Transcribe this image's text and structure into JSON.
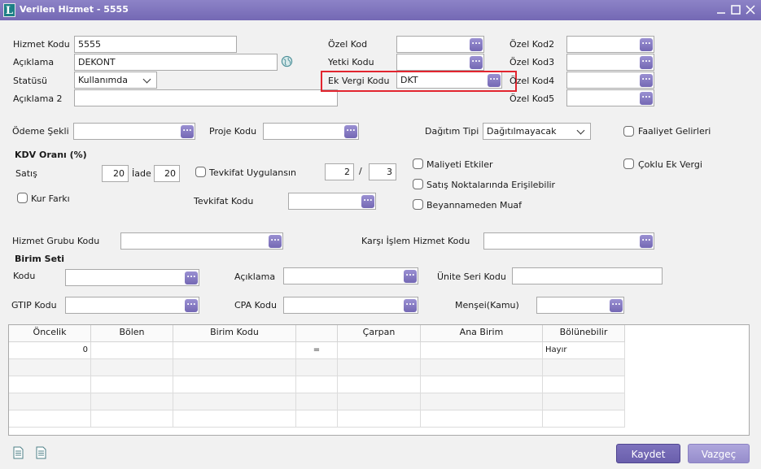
{
  "window": {
    "title": "Verilen Hizmet - 5555"
  },
  "form": {
    "hizmet_kodu_label": "Hizmet Kodu",
    "hizmet_kodu": "5555",
    "aciklama_label": "Açıklama",
    "aciklama": "DEKONT",
    "statusu_label": "Statüsü",
    "statusu": "Kullanımda",
    "aciklama2_label": "Açıklama 2",
    "aciklama2": "",
    "ozel_kod_label": "Özel Kod",
    "yetki_kodu_label": "Yetki Kodu",
    "ek_vergi_kodu_label": "Ek Vergi Kodu",
    "ek_vergi_kodu": "DKT",
    "ozel_kod2_label": "Özel Kod2",
    "ozel_kod3_label": "Özel Kod3",
    "ozel_kod4_label": "Özel Kod4",
    "ozel_kod5_label": "Özel Kod5",
    "odeme_sekli_label": "Ödeme Şekli",
    "proje_kodu_label": "Proje Kodu",
    "dagitim_tipi_label": "Dağıtım Tipi",
    "dagitim_tipi": "Dağıtılmayacak",
    "faaliyet_gelirleri_label": "Faaliyet Gelirleri",
    "kdv_orani_label": "KDV Oranı (%)",
    "satis_label": "Satış",
    "satis": "20",
    "iade_label": "İade",
    "iade": "20",
    "tevkifat_uygulansin_label": "Tevkifat Uygulansın",
    "tevkifat_pay": "2",
    "tevkifat_sep": "/",
    "tevkifat_payda": "3",
    "maliyeti_etkiler_label": "Maliyeti Etkiler",
    "satis_noktalarinda_label": "Satış Noktalarında Erişilebilir",
    "beyannameden_muaf_label": "Beyannameden Muaf",
    "coklu_ek_vergi_label": "Çoklu Ek Vergi",
    "kur_farki_label": "Kur Farkı",
    "tevkifat_kodu_label": "Tevkifat Kodu",
    "hizmet_grubu_kodu_label": "Hizmet Grubu Kodu",
    "karsi_islem_label": "Karşı İşlem Hizmet Kodu",
    "birim_seti_label": "Birim Seti",
    "kodu_label": "Kodu",
    "aciklama_b_label": "Açıklama",
    "unite_seri_kodu_label": "Ünite Seri Kodu",
    "gtip_kodu_label": "GTIP Kodu",
    "cpa_kodu_label": "CPA Kodu",
    "mensei_label": "Menşei(Kamu)",
    "lookup_glyph": "..."
  },
  "grid": {
    "columns": [
      "Öncelik",
      "Bölen",
      "Birim Kodu",
      "",
      "Çarpan",
      "Ana Birim",
      "Bölünebilir"
    ],
    "row1": {
      "oncelik": "0",
      "esit": "=",
      "bolunebilir": "Hayır"
    }
  },
  "buttons": {
    "kaydet": "Kaydet",
    "vazgec": "Vazgeç"
  },
  "icons": {
    "globe": "globe-icon",
    "minimize": "minimize-icon",
    "maximize": "maximize-icon",
    "close": "close-icon",
    "doc": "document-icon"
  },
  "colors": {
    "title_bar": "#7468b4",
    "button": "#7a6fba",
    "highlight": "#e2252f"
  }
}
